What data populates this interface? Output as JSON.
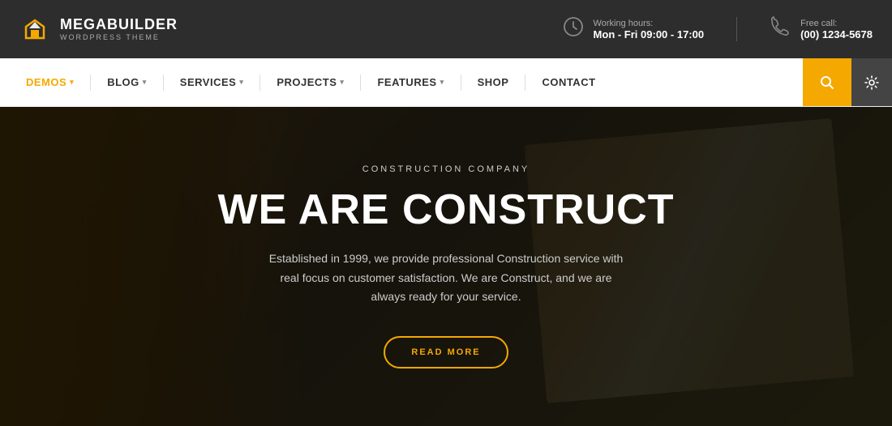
{
  "topbar": {
    "logo_title": "MEGABUILDER",
    "logo_sub": "WORDPRESS THEME",
    "working_label": "Working hours:",
    "working_value": "Mon - Fri 09:00 - 17:00",
    "call_label": "Free call:",
    "call_value": "(00) 1234-5678"
  },
  "nav": {
    "items": [
      {
        "label": "DEMOS",
        "has_dropdown": true,
        "active": true
      },
      {
        "label": "BLOG",
        "has_dropdown": true,
        "active": false
      },
      {
        "label": "SERVICES",
        "has_dropdown": true,
        "active": false
      },
      {
        "label": "PROJECTS",
        "has_dropdown": true,
        "active": false
      },
      {
        "label": "FEATURES",
        "has_dropdown": true,
        "active": false
      },
      {
        "label": "SHOP",
        "has_dropdown": false,
        "active": false
      },
      {
        "label": "CONTACT",
        "has_dropdown": false,
        "active": false
      }
    ],
    "search_icon": "🔍",
    "settings_icon": "⚙"
  },
  "hero": {
    "eyebrow": "CONSTRUCTION COMPANY",
    "title": "WE ARE CONSTRUCT",
    "description": "Established in 1999, we provide professional Construction service with real focus on customer satisfaction. We are Construct, and we are always ready for your service.",
    "cta_label": "READ MORE"
  }
}
